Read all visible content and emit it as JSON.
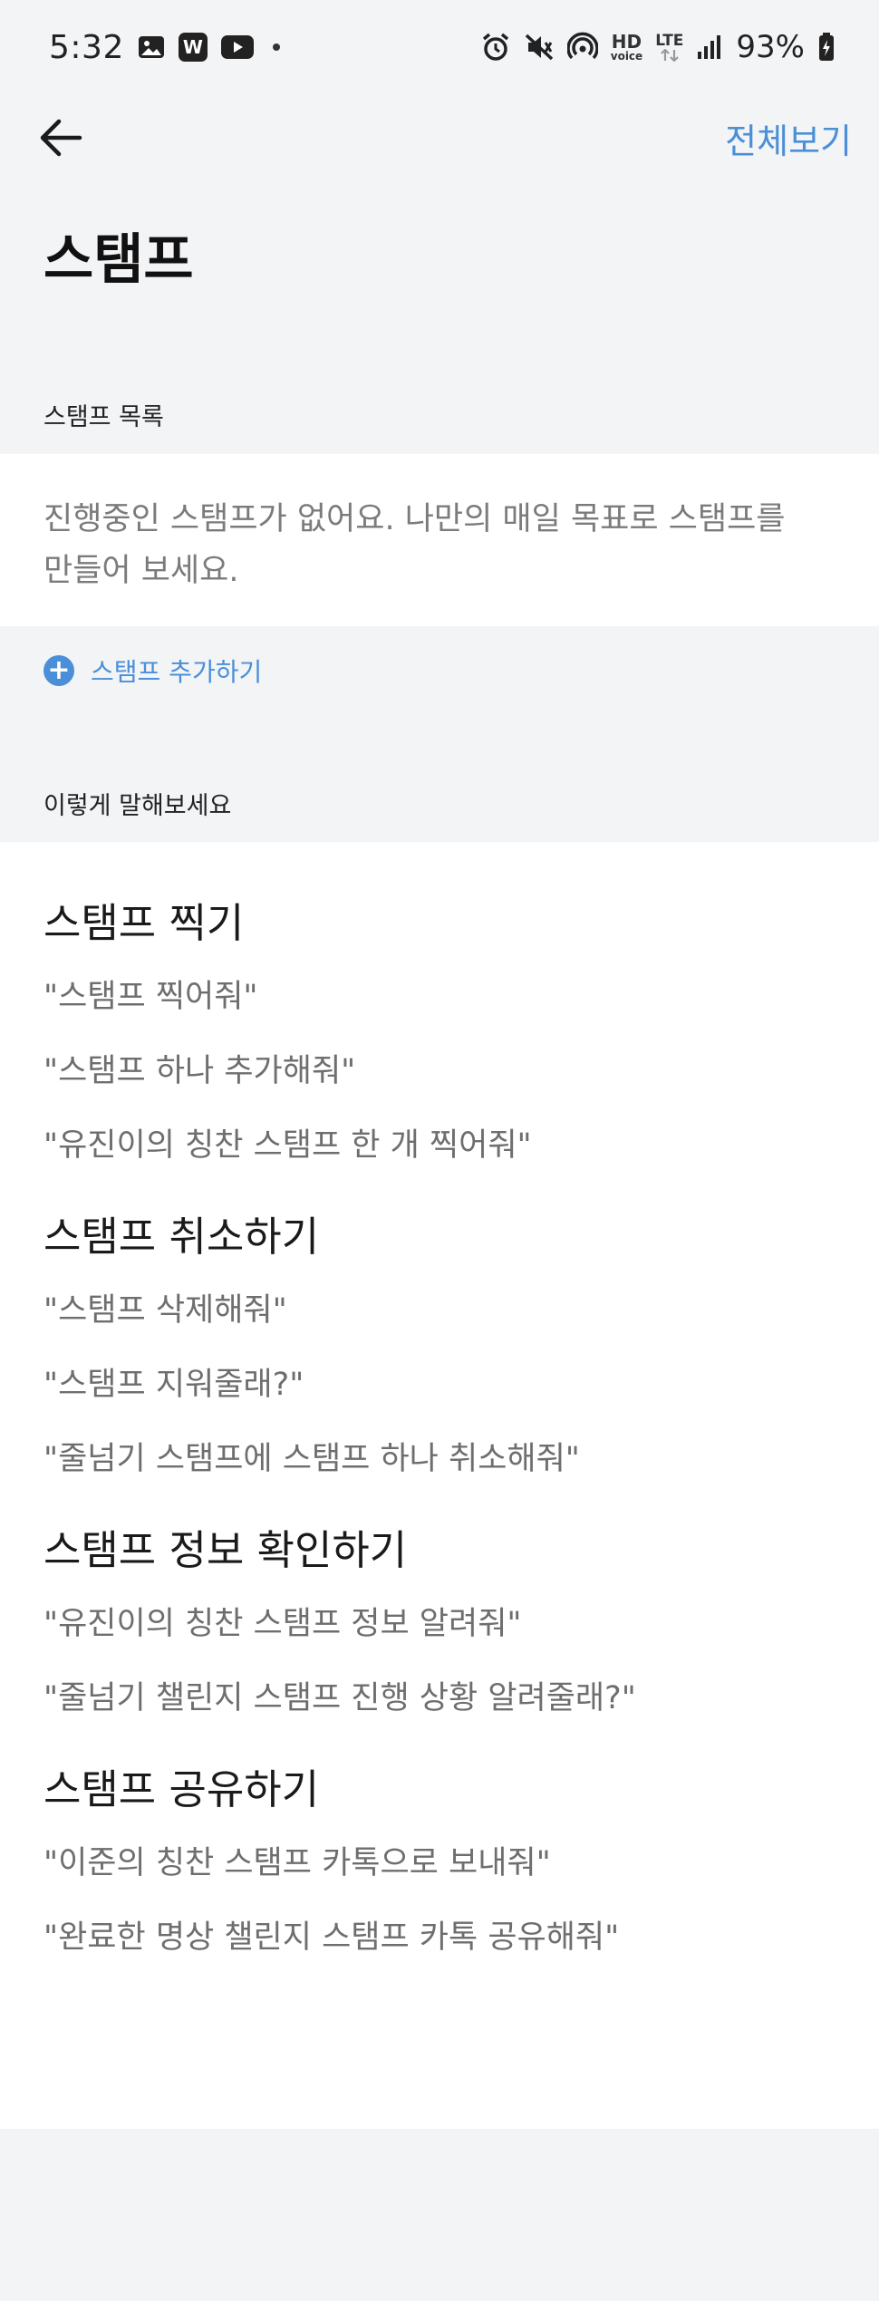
{
  "status_bar": {
    "time": "5:32",
    "battery": "93%",
    "left_icons": [
      "gallery-icon",
      "w-app-icon",
      "youtube-icon",
      "notification-dot-icon"
    ],
    "right_icons": [
      "alarm-icon",
      "mute-icon",
      "hotspot-icon",
      "hd-voice-icon",
      "lte-icon",
      "signal-icon",
      "battery-icon"
    ],
    "hd_label_1": "HD",
    "hd_label_2": "voice",
    "lte_label": "LTE"
  },
  "app_bar": {
    "back_icon": "arrow-left-icon",
    "view_all": "전체보기"
  },
  "page_title": "스탬프",
  "stamp_list": {
    "label": "스탬프 목록",
    "empty_message": "진행중인 스탬프가 없어요. 나만의 매일 목표로 스탬프를 만들어 보세요.",
    "add_button": "스탬프 추가하기"
  },
  "suggestions": {
    "label": "이렇게 말해보세요",
    "groups": [
      {
        "title": "스탬프 찍기",
        "phrases": [
          "\"스탬프 찍어줘\"",
          "\"스탬프 하나 추가해줘\"",
          "\"유진이의 칭찬 스탬프 한 개 찍어줘\""
        ]
      },
      {
        "title": "스탬프 취소하기",
        "phrases": [
          "\"스탬프 삭제해줘\"",
          "\"스탬프 지워줄래?\"",
          "\"줄넘기 스탬프에 스탬프 하나 취소해줘\""
        ]
      },
      {
        "title": "스탬프 정보 확인하기",
        "phrases": [
          "\"유진이의 칭찬 스탬프 정보 알려줘\"",
          "\"줄넘기 챌린지 스탬프 진행 상황 알려줄래?\""
        ]
      },
      {
        "title": "스탬프 공유하기",
        "phrases": [
          "\"이준의 칭찬 스탬프 카톡으로 보내줘\"",
          "\"완료한 명상 챌린지 스탬프 카톡 공유해줘\""
        ]
      }
    ]
  },
  "colors": {
    "accent": "#4a8fd8",
    "background": "#f3f4f6",
    "card": "#ffffff",
    "muted_text": "#7b7b7b"
  }
}
